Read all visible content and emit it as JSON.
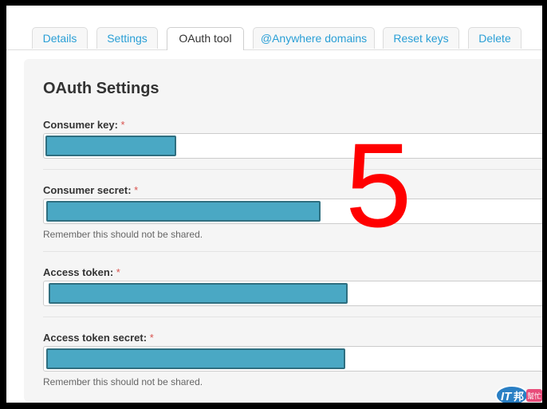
{
  "tabs": [
    {
      "label": "Details",
      "active": false
    },
    {
      "label": "Settings",
      "active": false
    },
    {
      "label": "OAuth tool",
      "active": true
    },
    {
      "label": "@Anywhere domains",
      "active": false
    },
    {
      "label": "Reset keys",
      "active": false
    },
    {
      "label": "Delete",
      "active": false
    }
  ],
  "panel": {
    "title": "OAuth Settings",
    "required_mark": "*",
    "fields": [
      {
        "label": "Consumer key:",
        "help": ""
      },
      {
        "label": "Consumer secret:",
        "help": "Remember this should not be shared."
      },
      {
        "label": "Access token:",
        "help": ""
      },
      {
        "label": "Access token secret:",
        "help": "Remember this should not be shared."
      }
    ]
  },
  "annotation": {
    "step_number": "5",
    "color": "#ff0000"
  },
  "watermark": {
    "text_a": "IT",
    "text_b": "邦",
    "text_c": "幫忙"
  },
  "colors": {
    "link": "#2a9fd6",
    "redaction": "#4aa8c4",
    "required": "#d9534f"
  }
}
